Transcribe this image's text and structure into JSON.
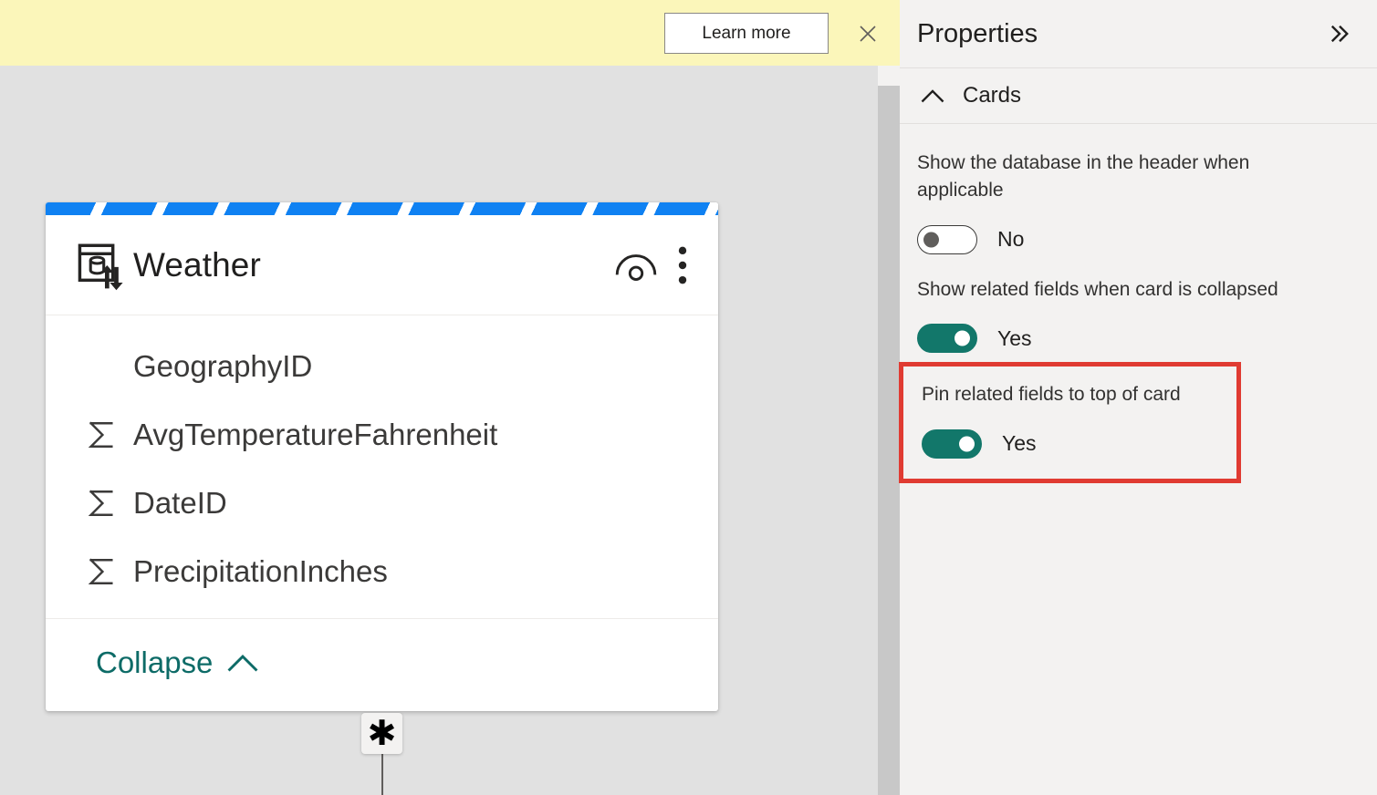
{
  "banner": {
    "learn_more_label": "Learn more",
    "close_icon": "close-icon",
    "background_color": "#fbf6ba"
  },
  "canvas": {
    "background_color": "#e1e1e1",
    "card": {
      "type_icon": "directquery-table-icon",
      "title": "Weather",
      "header_actions": [
        {
          "icon": "hide-preview-icon",
          "name": "preview-data-icon"
        },
        {
          "icon": "more-options-icon",
          "name": "more-options-icon"
        }
      ],
      "stripe_color": "#0f81f2",
      "fields": [
        {
          "icon": "",
          "label": "GeographyID"
        },
        {
          "icon": "sigma-icon",
          "label": "AvgTemperatureFahrenheit"
        },
        {
          "icon": "sigma-icon",
          "label": "DateID"
        },
        {
          "icon": "sigma-icon",
          "label": "PrecipitationInches"
        }
      ],
      "collapse_label": "Collapse",
      "collapse_icon": "chevron-up-icon"
    },
    "relationship": {
      "cardinality_symbol": "✱",
      "cardinality_name": "many"
    }
  },
  "properties_pane": {
    "title": "Properties",
    "collapse_icon": "double-chevron-right-icon",
    "section": {
      "title": "Cards",
      "chevron_icon": "chevron-up-icon",
      "expanded": true
    },
    "groups": [
      {
        "label": "Show the database in the header when applicable",
        "toggle_state": "off",
        "toggle_value": "No",
        "highlighted": false
      },
      {
        "label": "Show related fields when card is collapsed",
        "toggle_state": "on",
        "toggle_value": "Yes",
        "highlighted": false
      },
      {
        "label": "Pin related fields to top of card",
        "toggle_state": "on",
        "toggle_value": "Yes",
        "highlighted": true
      }
    ],
    "highlight_color": "#e03b32",
    "toggle_on_color": "#12776a",
    "background_color": "#f3f2f1"
  }
}
